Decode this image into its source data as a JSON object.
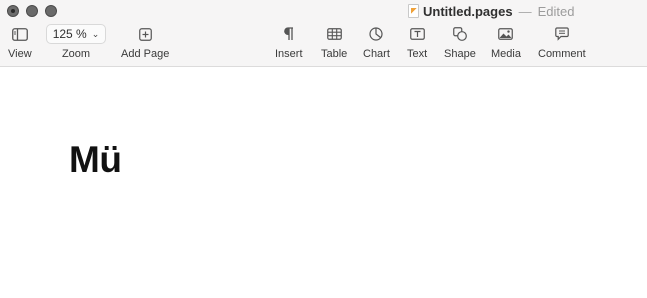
{
  "window": {
    "title": "Untitled.pages",
    "separator": "—",
    "state": "Edited"
  },
  "toolbar": {
    "view_label": "View",
    "zoom_value": "125 %",
    "zoom_label": "Zoom",
    "add_page_label": "Add Page",
    "insert_label": "Insert",
    "table_label": "Table",
    "chart_label": "Chart",
    "text_label": "Text",
    "shape_label": "Shape",
    "media_label": "Media",
    "comment_label": "Comment"
  },
  "document": {
    "text": "Mü"
  }
}
